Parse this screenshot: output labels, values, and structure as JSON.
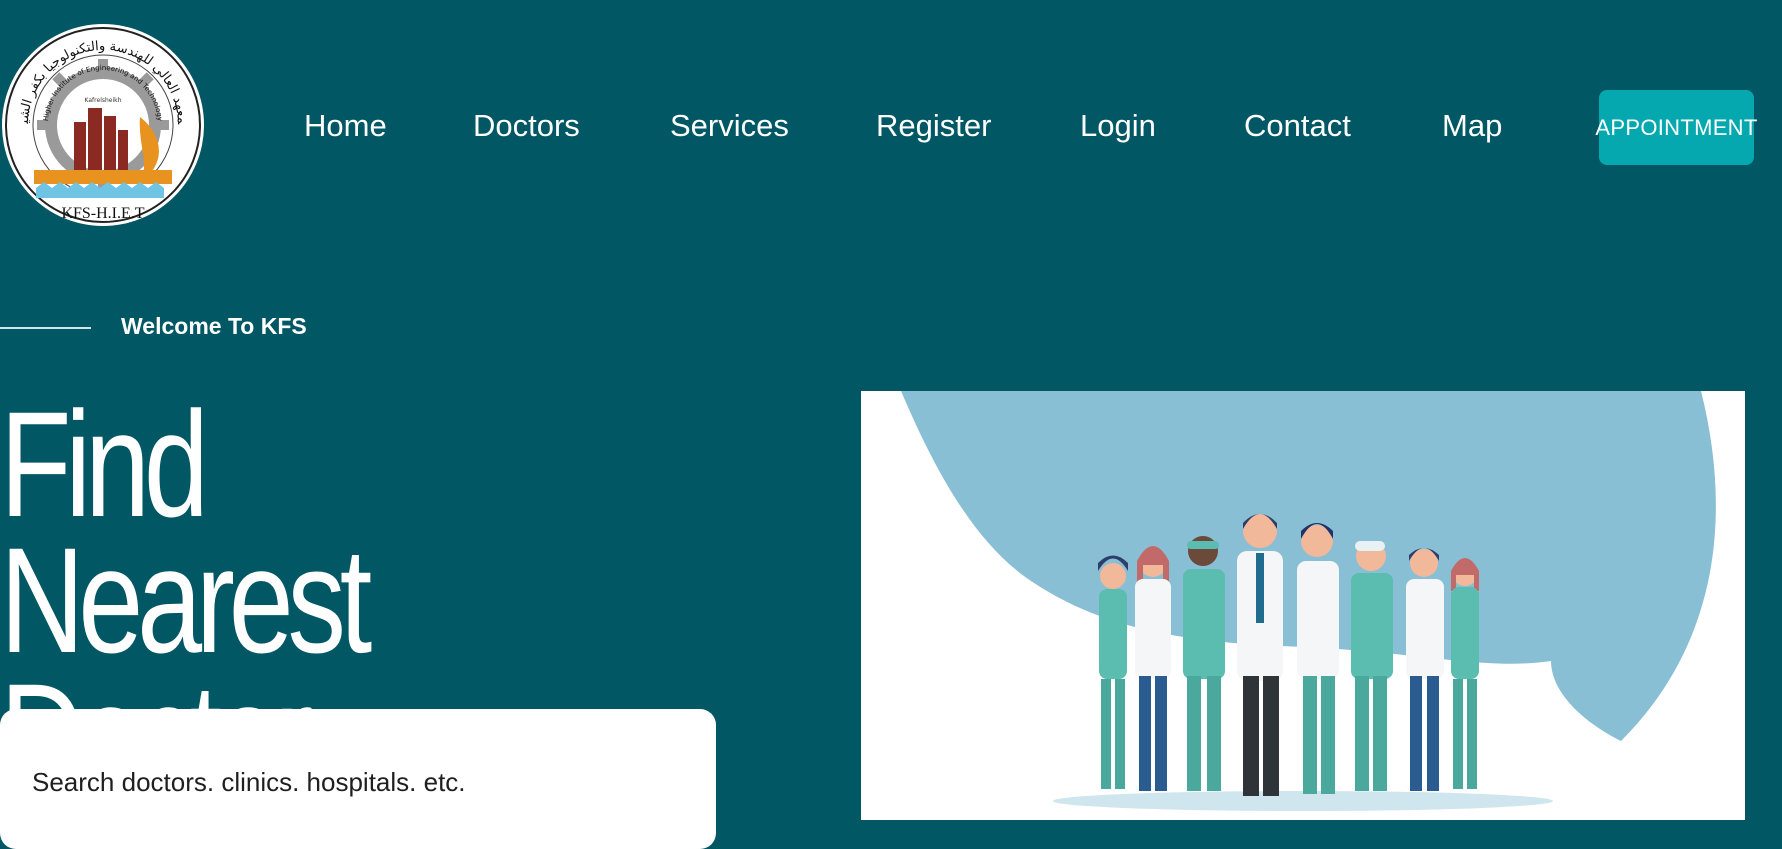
{
  "logo": {
    "arabic_arc_text": "المعهد العالي للهندسة والتكنولوجيا بكفر الشيخ",
    "english_arc_text": "Higher Institute of Engineering and Technology",
    "small_text": "Kafrelsheikh",
    "abbreviation": "KFS-H.I.E.T"
  },
  "nav": {
    "items": [
      "Home",
      "Doctors",
      "Services",
      "Register",
      "Login",
      "Contact",
      "Map"
    ],
    "appointment_label": "APPOINTMENT"
  },
  "hero": {
    "eyebrow": "Welcome To KFS",
    "headline_line1": "Find Nearest",
    "headline_line2": "Doctor.",
    "search_placeholder": "Search doctors. clinics. hospitals. etc."
  },
  "colors": {
    "background": "#015864",
    "accent_button": "#05a8ae",
    "illustration_blob": "#88bfd4",
    "illustration_scrubs": "#5bbcb0"
  },
  "illustration": {
    "icon": "medical-team-illustration"
  }
}
